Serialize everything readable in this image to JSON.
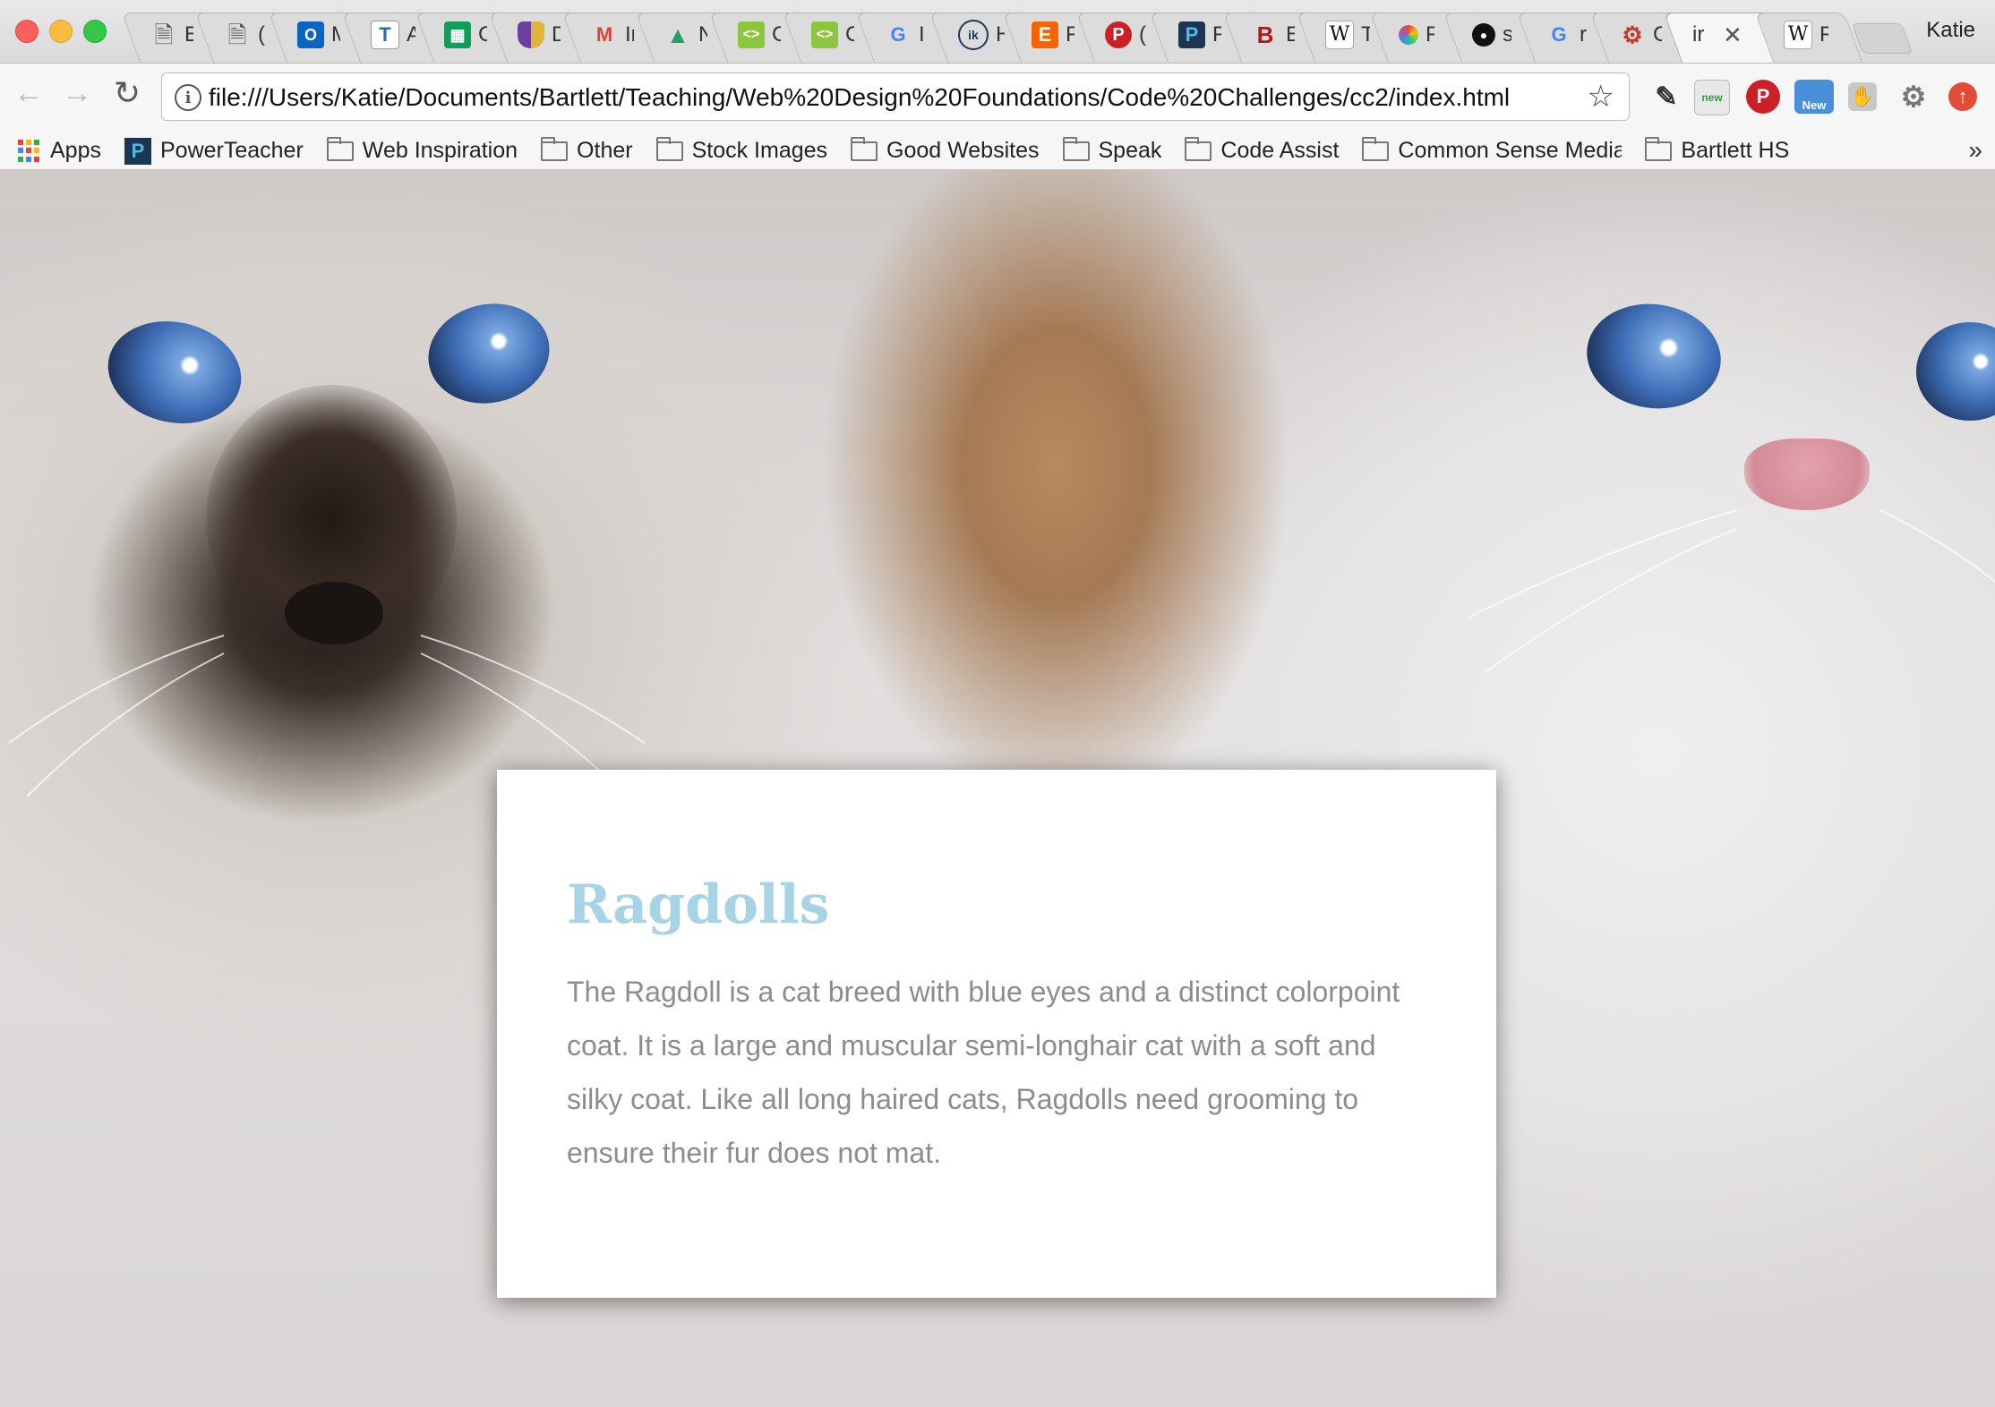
{
  "browser": {
    "profile_name": "Katie",
    "tabs": [
      {
        "icon": "page-icon",
        "label": "E"
      },
      {
        "icon": "page-icon",
        "label": "("
      },
      {
        "icon": "outlook-icon",
        "label": "M"
      },
      {
        "icon": "t-icon",
        "label": "A"
      },
      {
        "icon": "sheets-icon",
        "label": "C"
      },
      {
        "icon": "shield-icon",
        "label": "D"
      },
      {
        "icon": "gmail-icon",
        "label": "In"
      },
      {
        "icon": "drive-icon",
        "label": "N"
      },
      {
        "icon": "codepen-icon",
        "label": "C"
      },
      {
        "icon": "codepen-icon",
        "label": "C"
      },
      {
        "icon": "google-icon",
        "label": "I"
      },
      {
        "icon": "ik-icon",
        "label": "H"
      },
      {
        "icon": "e-icon",
        "label": "F"
      },
      {
        "icon": "pinterest-icon",
        "label": "("
      },
      {
        "icon": "powerteacher-icon",
        "label": "F"
      },
      {
        "icon": "b-icon",
        "label": "E"
      },
      {
        "icon": "wikipedia-icon",
        "label": "T"
      },
      {
        "icon": "colorwheel-icon",
        "label": "F"
      },
      {
        "icon": "github-icon",
        "label": "s"
      },
      {
        "icon": "google-icon",
        "label": "r"
      },
      {
        "icon": "gear-color-icon",
        "label": "C"
      },
      {
        "icon": "none",
        "label": "ir",
        "active": true
      },
      {
        "icon": "wikipedia-icon",
        "label": "F"
      }
    ],
    "address_bar": {
      "url": "file:///Users/Katie/Documents/Bartlett/Teaching/Web%20Design%20Foundations/Code%20Challenges/cc2/index.html"
    },
    "extensions": {
      "badge_new_1": "new",
      "badge_new_2": "New"
    },
    "bookmarks": [
      {
        "icon": "apps-icon",
        "label": "Apps"
      },
      {
        "icon": "powerteacher-icon",
        "label": "PowerTeacher"
      },
      {
        "icon": "folder-icon",
        "label": "Web Inspiration"
      },
      {
        "icon": "folder-icon",
        "label": "Other"
      },
      {
        "icon": "folder-icon",
        "label": "Stock Images"
      },
      {
        "icon": "folder-icon",
        "label": "Good Websites"
      },
      {
        "icon": "folder-icon",
        "label": "Speak"
      },
      {
        "icon": "folder-icon",
        "label": "Code Assist"
      },
      {
        "icon": "folder-icon",
        "label": "Common Sense Media"
      },
      {
        "icon": "folder-icon",
        "label": "Bartlett HS"
      }
    ]
  },
  "page": {
    "card": {
      "heading": "Ragdolls",
      "body": "The Ragdoll is a cat breed with blue eyes and a distinct colorpoint coat. It is a large and muscular semi-longhair cat with a soft and silky coat. Like all long haired cats, Ragdolls need grooming to ensure their fur does not mat."
    },
    "colors": {
      "heading": "#a6d4e5",
      "body_text": "#8c8c8c",
      "card_bg": "#ffffff"
    }
  }
}
